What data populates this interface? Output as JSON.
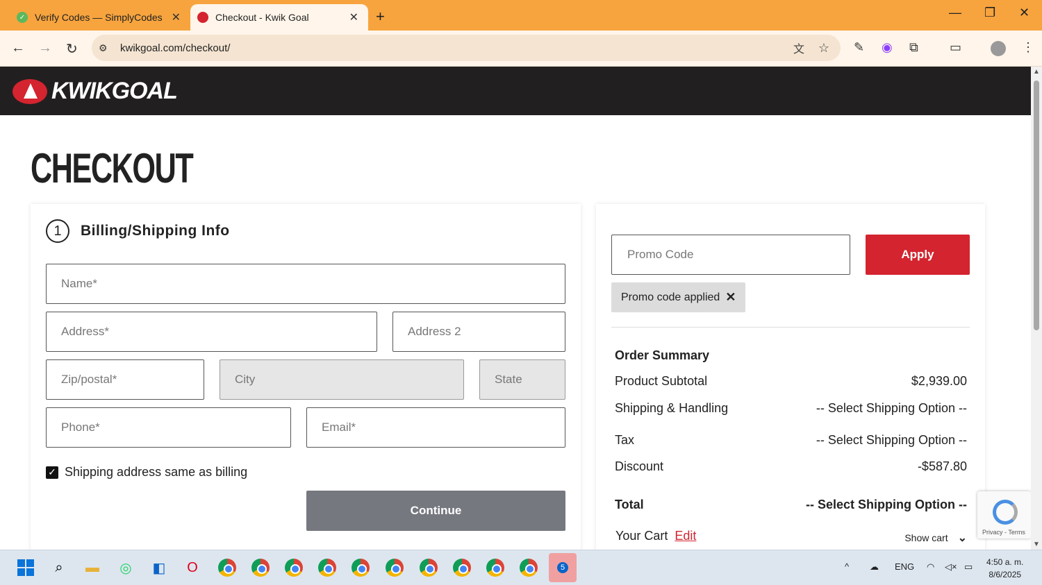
{
  "browser": {
    "tabs": [
      {
        "label": "Verify Codes — SimplyCodes",
        "active": false
      },
      {
        "label": "Checkout - Kwik Goal",
        "active": true
      }
    ],
    "url": "kwikgoal.com/checkout/"
  },
  "site": {
    "logo_text": "KWIKGOAL",
    "page_title": "CHECKOUT",
    "billing": {
      "step_number": "1",
      "step_label": "Billing/Shipping Info",
      "name_placeholder": "Name*",
      "address_placeholder": "Address*",
      "address2_placeholder": "Address 2",
      "zip_placeholder": "Zip/postal*",
      "city_placeholder": "City",
      "state_placeholder": "State",
      "phone_placeholder": "Phone*",
      "email_placeholder": "Email*",
      "same_address_label": "Shipping address same as billing",
      "same_address_checked": true,
      "continue_label": "Continue"
    },
    "summary": {
      "promo_placeholder": "Promo Code",
      "apply_label": "Apply",
      "promo_chip": "Promo code applied",
      "heading": "Order Summary",
      "rows": [
        {
          "label": "Product Subtotal",
          "value": "$2,939.00"
        },
        {
          "label": "Shipping & Handling",
          "value": "-- Select Shipping Option --"
        },
        {
          "label": "Tax",
          "value": "-- Select Shipping Option --"
        },
        {
          "label": "Discount",
          "value": "-$587.80"
        }
      ],
      "total_label": "Total",
      "total_value": "-- Select Shipping Option --",
      "cart_label": "Your Cart",
      "cart_edit": "Edit",
      "show_cart": "Show cart"
    },
    "recaptcha_text": "Privacy - Terms"
  },
  "taskbar": {
    "lang": "ENG",
    "time": "4:50 a. m.",
    "date": "8/6/2025",
    "badge_count": "5"
  },
  "colors": {
    "brand_red": "#d3242f",
    "header_dark": "#221f20",
    "tabbar": "#f7a43e"
  }
}
